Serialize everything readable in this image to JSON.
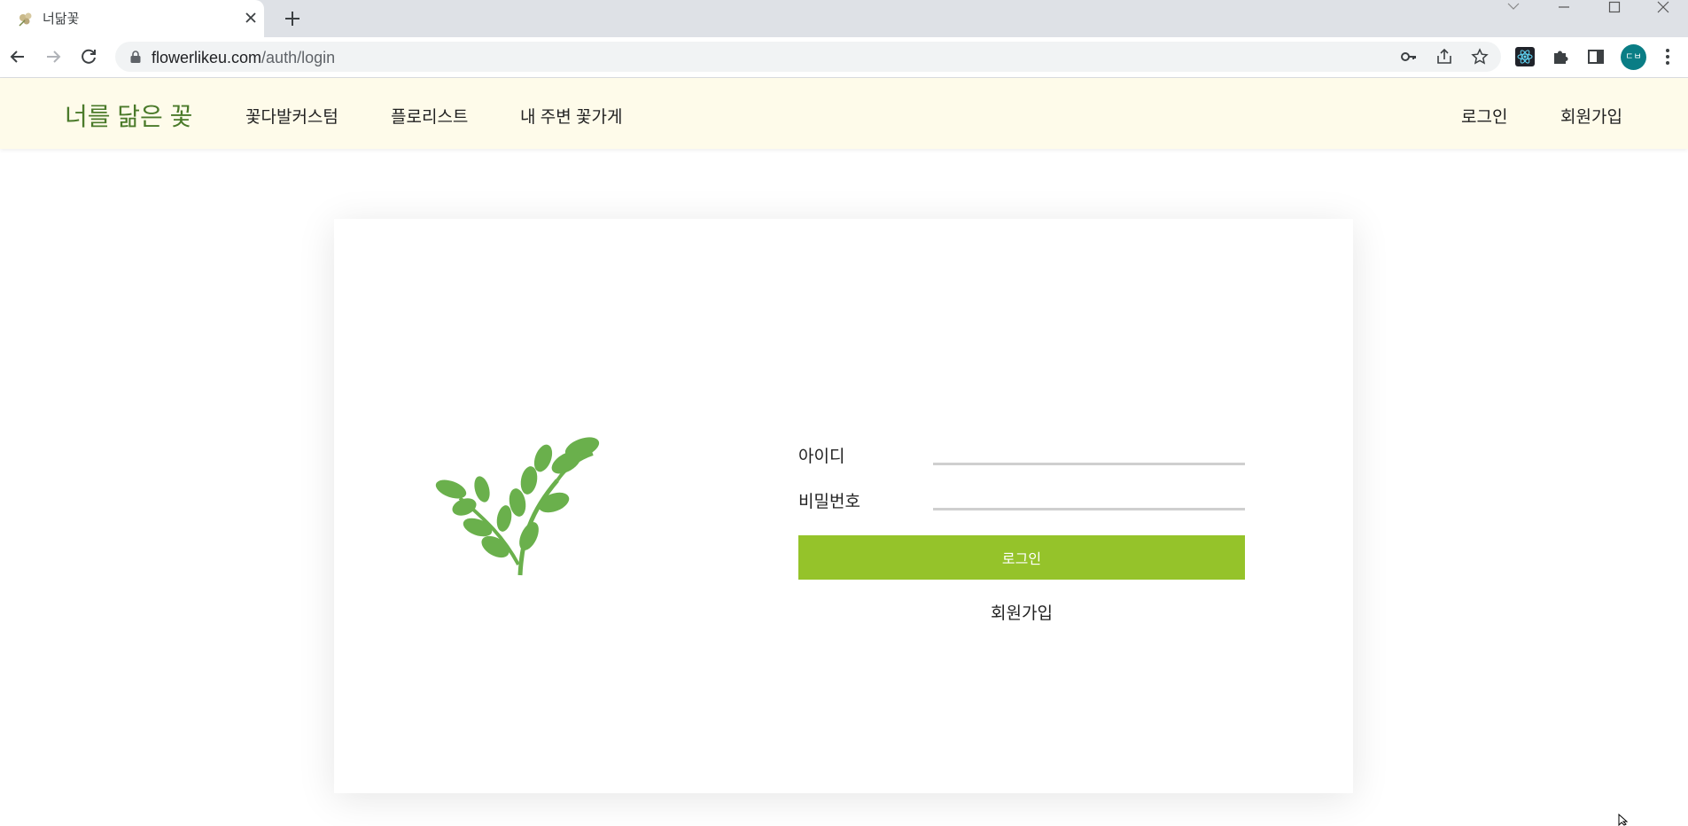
{
  "browser": {
    "tab_title": "너닮꽃",
    "url_host": "flowerlikeu.com",
    "url_path": "/auth/login",
    "profile_initials": "ㄷㅂ",
    "profile_color": "#0a7d85"
  },
  "site": {
    "brand": "너를 닮은 꽃",
    "nav": {
      "custom": "꽃다발커스텀",
      "florist": "플로리스트",
      "nearby": "내 주변 꽃가게",
      "login": "로그인",
      "signup": "회원가입"
    },
    "nav_bg": "#fefbea",
    "brand_color": "#4a7a2a"
  },
  "login_form": {
    "id_label": "아이디",
    "id_value": "",
    "password_label": "비밀번호",
    "password_value": "",
    "submit_label": "로그인",
    "signup_label": "회원가입",
    "button_color": "#95c32a"
  },
  "icons": [
    "flower-favicon-icon",
    "close-icon",
    "plus-icon",
    "back-icon",
    "forward-icon",
    "reload-icon",
    "lock-icon",
    "key-icon",
    "share-icon",
    "star-icon",
    "react-extension-icon",
    "puzzle-icon",
    "side-panel-icon",
    "menu-icon",
    "plant-illustration"
  ]
}
